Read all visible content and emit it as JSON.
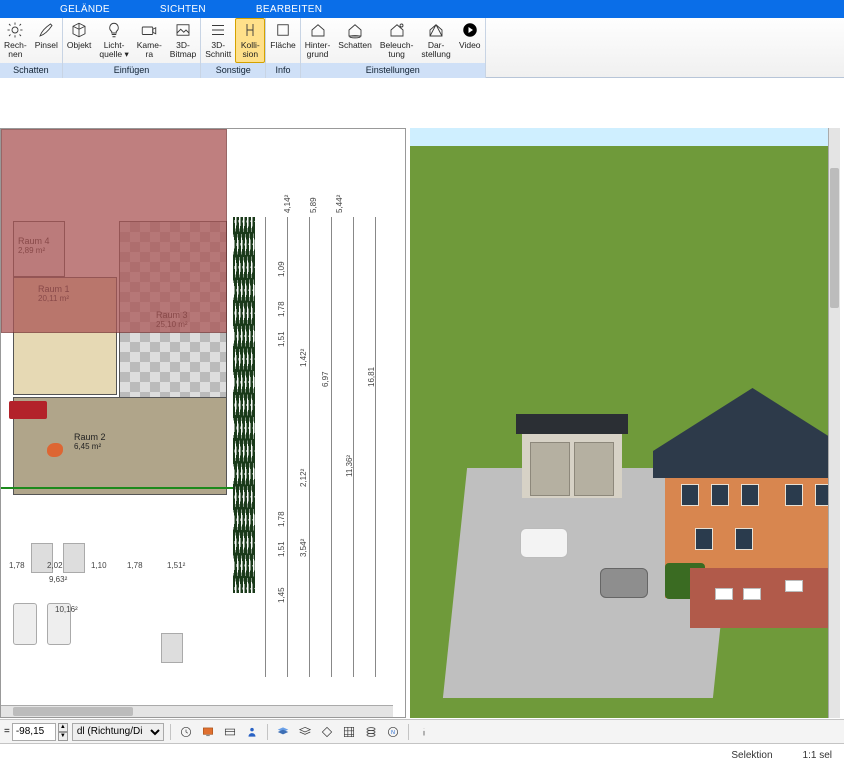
{
  "tabs": {
    "t1": "GELÄNDE",
    "t2": "SICHTEN",
    "t3": "BEARBEITEN"
  },
  "ribbon": {
    "groups": {
      "schatten": "Schatten",
      "einfuegen": "Einfügen",
      "sonstige": "Sonstige",
      "info": "Info",
      "einstell": "Einstellungen"
    },
    "btn": {
      "rechnen": "Rech-\nnen",
      "pinsel": "Pinsel",
      "objekt": "Objekt",
      "licht": "Licht-\nquelle ▾",
      "kamera": "Kame-\nra",
      "bitmap": "3D-\nBitmap",
      "schnitt": "3D-\nSchnitt",
      "kollision": "Kolli-\nsion",
      "flaeche": "Fläche",
      "hinterg": "Hinter-\ngrund",
      "schatt2": "Schatten",
      "beleucht": "Beleuch-\ntung",
      "darstell": "Dar-\nstellung",
      "video": "Video"
    }
  },
  "rooms": {
    "r4": {
      "name": "Raum 4",
      "area": "2,89 m²"
    },
    "r1": {
      "name": "Raum 1",
      "area": "20,11 m²"
    },
    "r3": {
      "name": "Raum 3",
      "area": "25,10 m²"
    },
    "r2": {
      "name": "Raum 2",
      "area": "6,45 m²"
    }
  },
  "dims": {
    "top": [
      "4,14²",
      "5,89",
      "5,44²"
    ],
    "right": [
      "1,09",
      "1,78",
      "1,51",
      "1,42²",
      "6,97",
      "16,81",
      "2,12²",
      "11,36²",
      "1,78",
      "1,51",
      "3,54²",
      "1,45"
    ],
    "patio_h": [
      "1,78",
      "2,02",
      "1,10",
      "1,78",
      "1,51²"
    ],
    "patio_tot": "9,63²",
    "patio_left": "10,16²"
  },
  "toolbar2": {
    "eq": "=",
    "value": "-98,15",
    "spin": {
      "up": "▲",
      "dn": "▼"
    },
    "combo": "dl (Richtung/Di"
  },
  "status": {
    "sel": "Selektion",
    "ratio": "1:1 sel"
  }
}
